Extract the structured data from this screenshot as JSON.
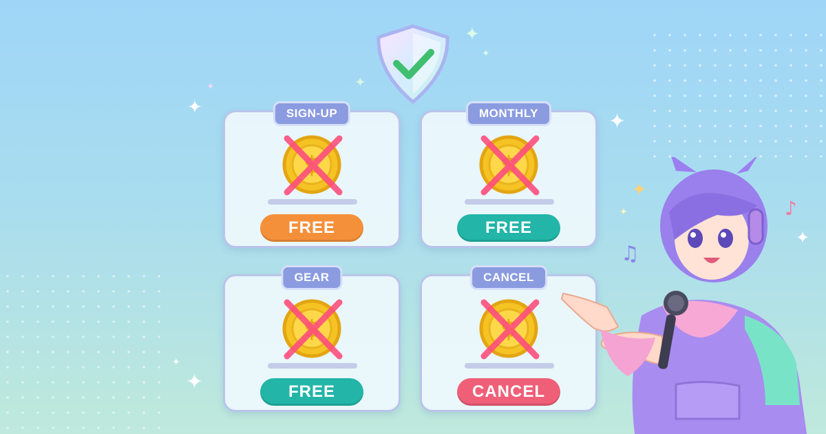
{
  "cards": [
    {
      "title": "SIGN-UP",
      "badge": "FREE",
      "badge_color": "#f5903a"
    },
    {
      "title": "MONTHLY",
      "badge": "FREE",
      "badge_color": "#22b5a8"
    },
    {
      "title": "GEAR",
      "badge": "FREE",
      "badge_color": "#22b5a8"
    },
    {
      "title": "CANCEL",
      "badge": "CANCEL",
      "badge_color": "#ef5f78"
    }
  ],
  "colors": {
    "card_border": "#b9c4ea",
    "tab_fill": "#8a9be0",
    "coin": "#f5c323",
    "cross": "#ff4f7c",
    "shield_check": "#3fbf6f"
  },
  "icons": {
    "shield": "shield-check-icon",
    "coin": "coin-icon",
    "cross": "cross-icon",
    "mic": "microphone-icon",
    "note": "music-note-icon"
  }
}
